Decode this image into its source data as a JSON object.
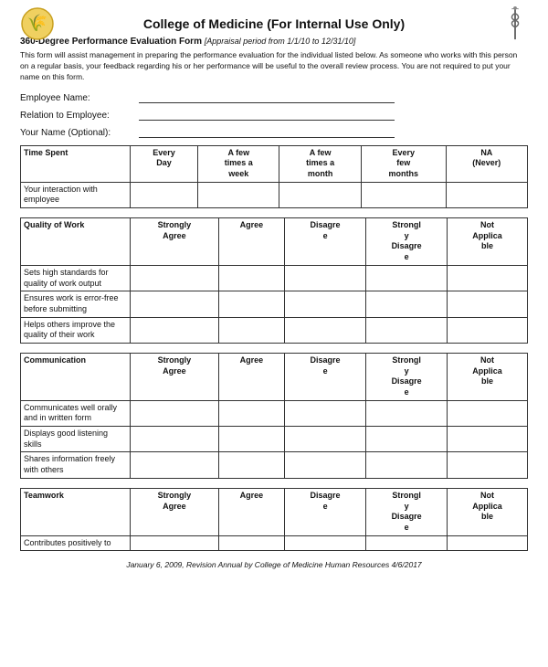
{
  "header": {
    "title": "College of Medicine (For Internal Use Only)"
  },
  "form": {
    "title_bold": "360-Degree Performance Evaluation Form",
    "title_italic": "[Appraisal period from 1/1/10 to 12/31/10]",
    "description": "This form will assist management in preparing the performance evaluation for the individual listed below. As someone who works with this person on a regular basis, your feedback regarding his or her performance will be useful to the overall review process. You are not required to put your name on this form.",
    "fields": [
      {
        "label": "Employee Name:",
        "placeholder": ""
      },
      {
        "label": "Relation to Employee:",
        "placeholder": ""
      },
      {
        "label": "Your Name (Optional):",
        "placeholder": ""
      }
    ]
  },
  "table1": {
    "section": "Time Spent",
    "columns": [
      "Every Day",
      "A few times a week",
      "A few times a month",
      "Every few months",
      "NA (Never)"
    ],
    "rows": [
      "Your interaction with employee"
    ]
  },
  "table2": {
    "section": "Quality of Work",
    "columns": [
      "Strongly Agree",
      "Agree",
      "Disagree",
      "Strongly Disagree",
      "Not Applicable"
    ],
    "rows": [
      "Sets high standards for quality of work output",
      "Ensures work is error-free before submitting",
      "Helps others improve the quality of their work"
    ]
  },
  "table3": {
    "section": "Communication",
    "columns": [
      "Strongly Agree",
      "Agree",
      "Disagree",
      "Strongly Disagree",
      "Not Applicable"
    ],
    "rows": [
      "Communicates well orally and in written form",
      "Displays good listening skills",
      "Shares information freely with others"
    ]
  },
  "table4": {
    "section": "Teamwork",
    "columns": [
      "Strongly Agree",
      "Agree",
      "Disagree",
      "Strongly Disagree",
      "Not Applicable"
    ],
    "rows": [
      "Contributes positively to"
    ]
  },
  "footer": "January 6, 2009, Revision Annual by College of Medicine Human Resources 4/6/2017"
}
